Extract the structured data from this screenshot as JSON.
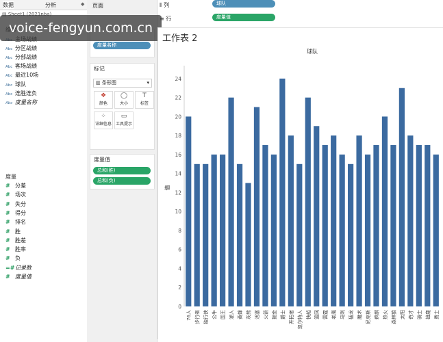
{
  "tabs": [
    "数据",
    "分析"
  ],
  "data_source": "Sheet1 (2021nba)",
  "dimensions_label": "维度",
  "dimension_fields": [
    {
      "type": "Abc",
      "name": "主场战绩",
      "italic": false
    },
    {
      "type": "Abc",
      "name": "分区战绩",
      "italic": false
    },
    {
      "type": "Abc",
      "name": "分部战绩",
      "italic": false
    },
    {
      "type": "Abc",
      "name": "客场战绩",
      "italic": false
    },
    {
      "type": "Abc",
      "name": "最近10场",
      "italic": false
    },
    {
      "type": "Abc",
      "name": "球队",
      "italic": false
    },
    {
      "type": "Abc",
      "name": "连胜连负",
      "italic": false
    },
    {
      "type": "Abc",
      "name": "度量名称",
      "italic": true
    }
  ],
  "measures_label": "度量",
  "measure_fields": [
    {
      "type": "#",
      "name": "分差",
      "italic": false
    },
    {
      "type": "#",
      "name": "场次",
      "italic": false
    },
    {
      "type": "#",
      "name": "失分",
      "italic": false
    },
    {
      "type": "#",
      "name": "得分",
      "italic": false
    },
    {
      "type": "#",
      "name": "排名",
      "italic": false
    },
    {
      "type": "#",
      "name": "胜",
      "italic": false
    },
    {
      "type": "#",
      "name": "胜差",
      "italic": false
    },
    {
      "type": "#",
      "name": "胜率",
      "italic": false
    },
    {
      "type": "#",
      "name": "负",
      "italic": false
    },
    {
      "type": "=#",
      "name": "记录数",
      "italic": true
    },
    {
      "type": "#",
      "name": "度量值",
      "italic": true
    }
  ],
  "pages_label": "页面",
  "filters_pill": "度量名称",
  "marks_label": "标记",
  "mark_type": "条形图",
  "mark_buttons": [
    "颜色",
    "大小",
    "标签",
    "详细信息",
    "工具提示"
  ],
  "measure_values_label": "度量值",
  "measure_values_pills": [
    "总和(胜)",
    "总和(负)"
  ],
  "columns_label": "列",
  "columns_pill": "球队",
  "rows_label": "行",
  "rows_pill": "度量值",
  "watermark": "voice-fengyun.com.cn",
  "sheet_title": "工作表 2",
  "colors": {
    "bar": "#3b6aa0",
    "pill_blue": "#4d8fb8",
    "pill_green": "#2aa567"
  },
  "chart_data": {
    "type": "bar",
    "title": "球队",
    "ylabel": "值",
    "ylim": [
      0,
      25
    ],
    "yticks": [
      0,
      2,
      4,
      6,
      8,
      10,
      12,
      14,
      16,
      18,
      20,
      22,
      24
    ],
    "categories": [
      "76人",
      "步行者",
      "独行侠",
      "公牛",
      "国王",
      "湖人",
      "黄蜂",
      "灰熊",
      "活塞",
      "火箭",
      "掘金",
      "爵士",
      "开拓者",
      "凯尔特人",
      "快船",
      "篮网",
      "雷霆",
      "老鹰",
      "马刺",
      "猛龙",
      "魔术",
      "尼克斯",
      "鹈鹕",
      "热火",
      "森林狼",
      "太阳",
      "奇才",
      "骑士",
      "雄鹿",
      "勇士"
    ],
    "values": [
      20,
      15,
      15,
      16,
      16,
      22,
      15,
      13,
      21,
      17,
      16,
      24,
      18,
      15,
      22,
      19,
      17,
      18,
      16,
      15,
      18,
      16,
      17,
      20,
      17,
      23,
      18,
      17,
      17,
      16
    ]
  }
}
